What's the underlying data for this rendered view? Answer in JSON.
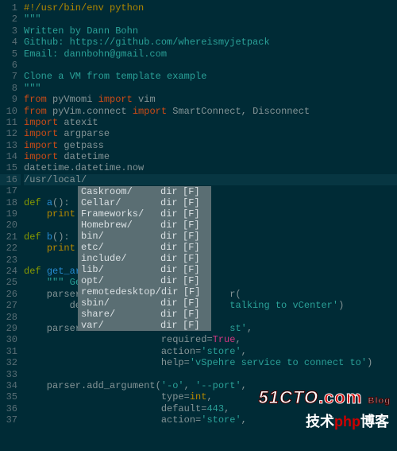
{
  "lines": [
    {
      "n": 1,
      "tokens": [
        [
          "c-comment",
          "#!/usr/bin/env python"
        ]
      ]
    },
    {
      "n": 2,
      "tokens": [
        [
          "c-string",
          "\"\"\""
        ]
      ]
    },
    {
      "n": 3,
      "tokens": [
        [
          "c-string",
          "Written by Dann Bohn"
        ]
      ]
    },
    {
      "n": 4,
      "tokens": [
        [
          "c-string",
          "Github: https://github.com/whereismyjetpack"
        ]
      ]
    },
    {
      "n": 5,
      "tokens": [
        [
          "c-string",
          "Email: dannbohn@gmail.com"
        ]
      ]
    },
    {
      "n": 6,
      "tokens": [
        [
          "",
          ""
        ]
      ]
    },
    {
      "n": 7,
      "tokens": [
        [
          "c-string",
          "Clone a VM from template example"
        ]
      ]
    },
    {
      "n": 8,
      "tokens": [
        [
          "c-string",
          "\"\"\""
        ]
      ]
    },
    {
      "n": 9,
      "tokens": [
        [
          "c-import",
          "from "
        ],
        [
          "c-default",
          "pyVmomi "
        ],
        [
          "c-import",
          "import "
        ],
        [
          "c-default",
          "vim"
        ]
      ]
    },
    {
      "n": 10,
      "tokens": [
        [
          "c-import",
          "from "
        ],
        [
          "c-default",
          "pyVim.connect "
        ],
        [
          "c-import",
          "import "
        ],
        [
          "c-default",
          "SmartConnect, Disconnect"
        ]
      ]
    },
    {
      "n": 11,
      "tokens": [
        [
          "c-import",
          "import "
        ],
        [
          "c-default",
          "atexit"
        ]
      ]
    },
    {
      "n": 12,
      "tokens": [
        [
          "c-import",
          "import "
        ],
        [
          "c-default",
          "argparse"
        ]
      ]
    },
    {
      "n": 13,
      "tokens": [
        [
          "c-import",
          "import "
        ],
        [
          "c-default",
          "getpass"
        ]
      ]
    },
    {
      "n": 14,
      "tokens": [
        [
          "c-import",
          "import "
        ],
        [
          "c-default",
          "datetime"
        ]
      ]
    },
    {
      "n": 15,
      "tokens": [
        [
          "c-default",
          "datetime.datetime.now"
        ]
      ]
    },
    {
      "n": 16,
      "curr": true,
      "tokens": [
        [
          "c-default",
          "/usr/local/"
        ]
      ]
    },
    {
      "n": 17,
      "tokens": [
        [
          "",
          ""
        ]
      ]
    },
    {
      "n": 18,
      "mark": ">",
      "tokens": [
        [
          "c-keyword",
          "def "
        ],
        [
          "c-func",
          "a"
        ],
        [
          "c-default",
          "():"
        ]
      ]
    },
    {
      "n": 19,
      "tokens": [
        [
          "c-default",
          "    "
        ],
        [
          "c-builtin",
          "print"
        ]
      ]
    },
    {
      "n": 20,
      "tokens": [
        [
          "",
          ""
        ]
      ]
    },
    {
      "n": 21,
      "mark": ">",
      "tokens": [
        [
          "c-keyword",
          "def "
        ],
        [
          "c-func",
          "b"
        ],
        [
          "c-default",
          "():"
        ]
      ]
    },
    {
      "n": 22,
      "tokens": [
        [
          "c-default",
          "    "
        ],
        [
          "c-builtin",
          "print"
        ]
      ]
    },
    {
      "n": 23,
      "tokens": [
        [
          "",
          ""
        ]
      ]
    },
    {
      "n": 24,
      "mark": ">",
      "tokens": [
        [
          "c-keyword",
          "def "
        ],
        [
          "c-func",
          "get_ar"
        ]
      ]
    },
    {
      "n": 25,
      "tokens": [
        [
          "c-default",
          "    "
        ],
        [
          "c-string",
          "\"\"\" Ge"
        ]
      ]
    },
    {
      "n": 26,
      "tokens": [
        [
          "c-default",
          "    parser                          r("
        ]
      ]
    },
    {
      "n": 27,
      "tokens": [
        [
          "c-default",
          "        de                          "
        ],
        [
          "c-string",
          "talking to vCenter'"
        ],
        [
          "c-default",
          ")"
        ]
      ]
    },
    {
      "n": 28,
      "tokens": [
        [
          "",
          ""
        ]
      ]
    },
    {
      "n": 29,
      "tokens": [
        [
          "c-default",
          "    parser                          "
        ],
        [
          "c-string",
          "st'"
        ],
        [
          "c-default",
          ","
        ]
      ]
    },
    {
      "n": 30,
      "tokens": [
        [
          "c-default",
          "                        "
        ],
        [
          "c-param",
          "required"
        ],
        [
          "c-default",
          "="
        ],
        [
          "c-bool",
          "True"
        ],
        [
          "c-default",
          ","
        ]
      ]
    },
    {
      "n": 31,
      "tokens": [
        [
          "c-default",
          "                        "
        ],
        [
          "c-param",
          "action"
        ],
        [
          "c-default",
          "="
        ],
        [
          "c-string",
          "'store'"
        ],
        [
          "c-default",
          ","
        ]
      ]
    },
    {
      "n": 32,
      "tokens": [
        [
          "c-default",
          "                        "
        ],
        [
          "c-param",
          "help"
        ],
        [
          "c-default",
          "="
        ],
        [
          "c-string",
          "'vSpehre service to connect to'"
        ],
        [
          "c-default",
          ")"
        ]
      ]
    },
    {
      "n": 33,
      "tokens": [
        [
          "",
          ""
        ]
      ]
    },
    {
      "n": 34,
      "tokens": [
        [
          "c-default",
          "    parser.add_argument("
        ],
        [
          "c-string",
          "'-o'"
        ],
        [
          "c-default",
          ", "
        ],
        [
          "c-string",
          "'--port'"
        ],
        [
          "c-default",
          ","
        ]
      ]
    },
    {
      "n": 35,
      "tokens": [
        [
          "c-default",
          "                        "
        ],
        [
          "c-param",
          "type"
        ],
        [
          "c-default",
          "="
        ],
        [
          "c-builtin",
          "int"
        ],
        [
          "c-default",
          ","
        ]
      ]
    },
    {
      "n": 36,
      "tokens": [
        [
          "c-default",
          "                        "
        ],
        [
          "c-param",
          "default"
        ],
        [
          "c-default",
          "="
        ],
        [
          "c-number",
          "443"
        ],
        [
          "c-default",
          ","
        ]
      ]
    },
    {
      "n": 37,
      "tokens": [
        [
          "c-default",
          "                        "
        ],
        [
          "c-param",
          "action"
        ],
        [
          "c-default",
          "="
        ],
        [
          "c-string",
          "'store'"
        ],
        [
          "c-default",
          ","
        ]
      ]
    }
  ],
  "sign_rows": [
    16,
    18,
    21,
    24,
    25
  ],
  "popup": {
    "items": [
      {
        "name": "Caskroom/",
        "kind": "dir",
        "flag": "[F]"
      },
      {
        "name": "Cellar/",
        "kind": "dir",
        "flag": "[F]"
      },
      {
        "name": "Frameworks/",
        "kind": "dir",
        "flag": "[F]"
      },
      {
        "name": "Homebrew/",
        "kind": "dir",
        "flag": "[F]"
      },
      {
        "name": "bin/",
        "kind": "dir",
        "flag": "[F]"
      },
      {
        "name": "etc/",
        "kind": "dir",
        "flag": "[F]"
      },
      {
        "name": "include/",
        "kind": "dir",
        "flag": "[F]"
      },
      {
        "name": "lib/",
        "kind": "dir",
        "flag": "[F]"
      },
      {
        "name": "opt/",
        "kind": "dir",
        "flag": "[F]"
      },
      {
        "name": "remotedesktop/",
        "kind": "dir",
        "flag": "[F]"
      },
      {
        "name": "sbin/",
        "kind": "dir",
        "flag": "[F]"
      },
      {
        "name": "share/",
        "kind": "dir",
        "flag": "[F]"
      },
      {
        "name": "var/",
        "kind": "dir",
        "flag": "[F]"
      }
    ]
  },
  "watermark1": {
    "text": "51CTO",
    "red": ".com",
    "blog": "Blog"
  },
  "watermark2": {
    "pre": "技术",
    "php": "php",
    "post": "博客"
  }
}
